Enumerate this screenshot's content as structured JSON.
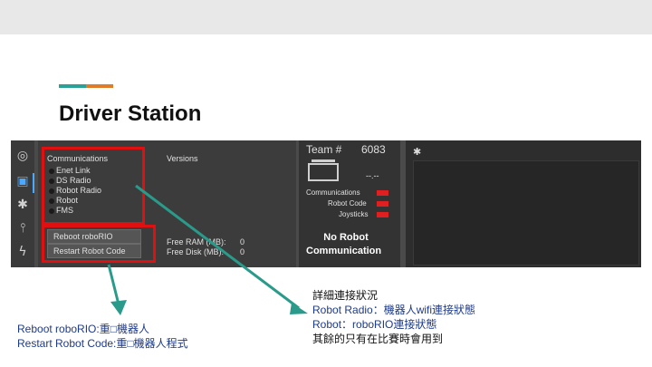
{
  "slide": {
    "title": "Driver Station",
    "accent_colors": [
      "#2aa198",
      "#e07b28"
    ]
  },
  "driver_station": {
    "sidebar_icons": [
      "steering-wheel-icon",
      "diagnostics-icon",
      "gear-icon",
      "usb-icon",
      "power-icon"
    ],
    "communications": {
      "header": "Communications",
      "items": [
        "Enet Link",
        "DS Radio",
        "Robot Radio",
        "Robot",
        "FMS"
      ]
    },
    "versions_label": "Versions",
    "buttons": {
      "reboot": "Reboot roboRIO",
      "restart": "Restart Robot Code"
    },
    "memory": {
      "free_ram_label": "Free RAM (MB):",
      "free_ram_value": "0",
      "free_disk_label": "Free Disk (MB):",
      "free_disk_value": "0"
    },
    "status": {
      "team_label": "Team #",
      "team_number": "6083",
      "battery_voltage": "--.--",
      "indicators": [
        "Communications",
        "Robot Code",
        "Joysticks"
      ],
      "indicator_color": "#e02020",
      "message_line1": "No Robot",
      "message_line2": "Communication"
    }
  },
  "annotations": {
    "left": [
      "Reboot roboRIO:重□機器人",
      "Restart Robot Code:重□機器人程式"
    ],
    "right": [
      "詳細連接狀況",
      "Robot Radio：機器人wifi連接狀態",
      "Robot：roboRIO連接狀態",
      "其餘的只有在比賽時會用到"
    ]
  }
}
